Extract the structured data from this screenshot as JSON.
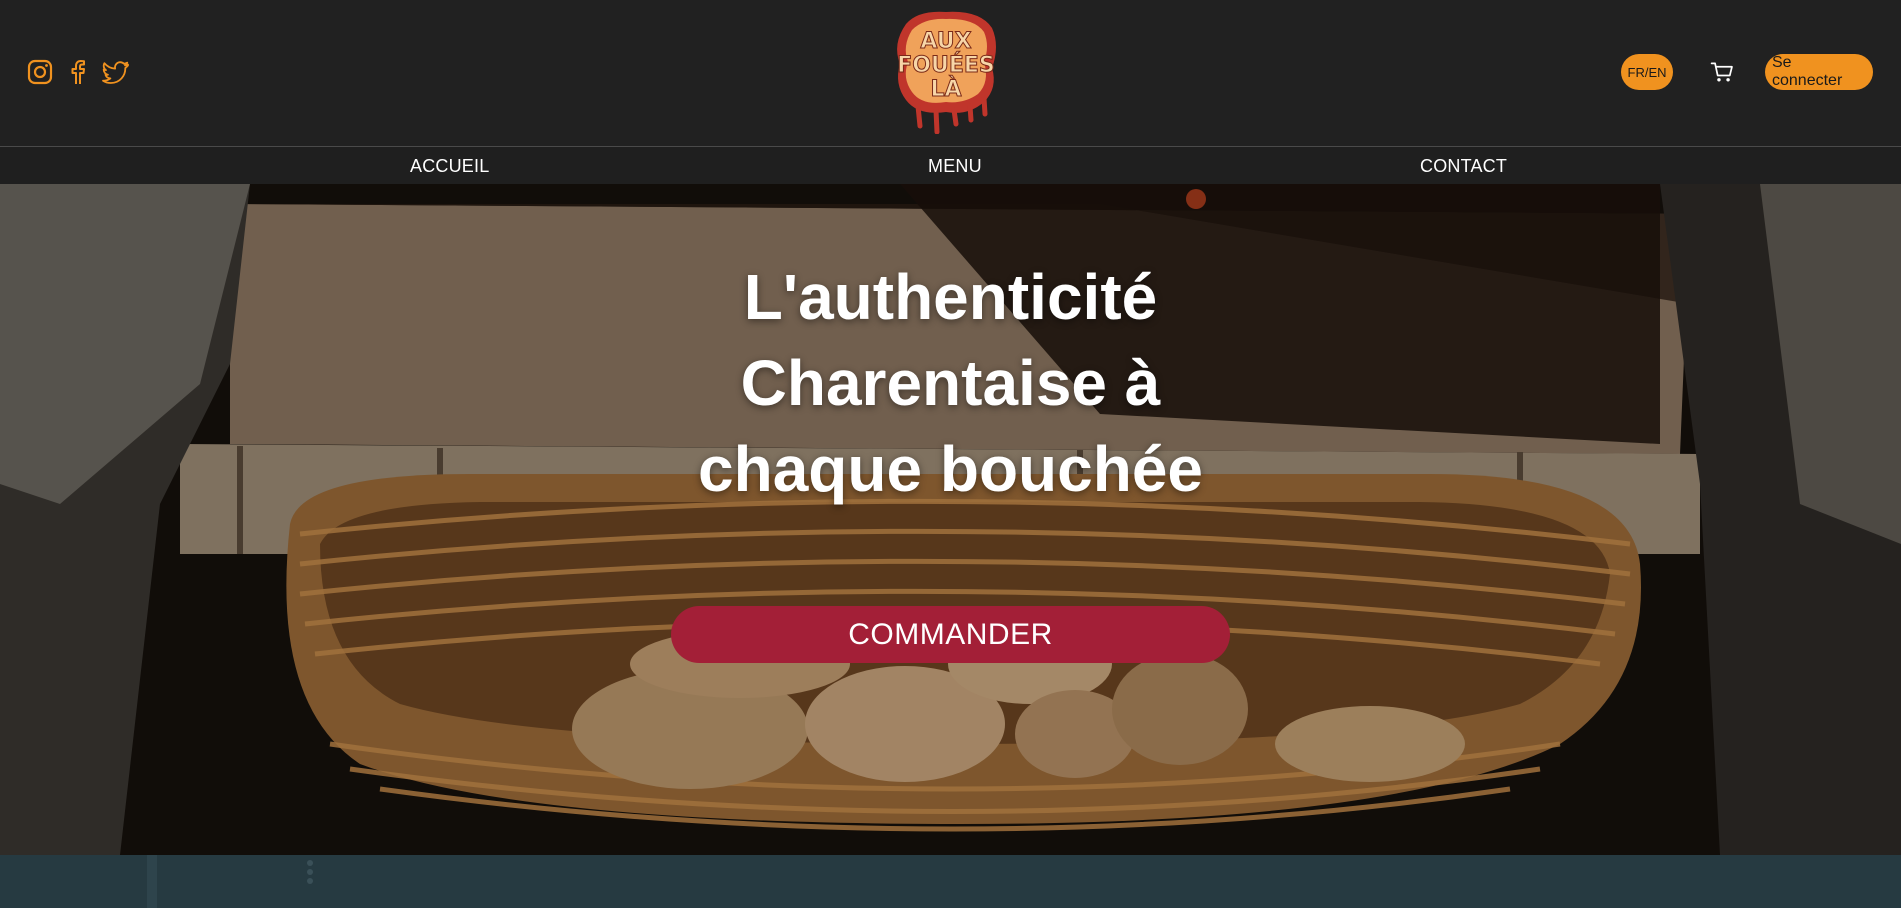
{
  "header": {
    "social": [
      {
        "icon": "instagram-icon"
      },
      {
        "icon": "facebook-icon"
      },
      {
        "icon": "twitter-icon"
      }
    ],
    "logo_text": "AUX FOUÉES LÀ",
    "lang_label": "FR/EN",
    "login_label": "Se connecter",
    "accent_color": "#f0921f"
  },
  "nav": {
    "items": [
      {
        "label": "ACCUEIL"
      },
      {
        "label": "MENU"
      },
      {
        "label": "CONTACT"
      }
    ]
  },
  "hero": {
    "line1": "L'authenticité",
    "line2_bold": "Charentaise",
    "line2_rest": " à",
    "line3_plain": "chaque ",
    "line3_bold": "bouchée",
    "cta_label": "COMMANDER",
    "cta_color": "#a31f37"
  }
}
